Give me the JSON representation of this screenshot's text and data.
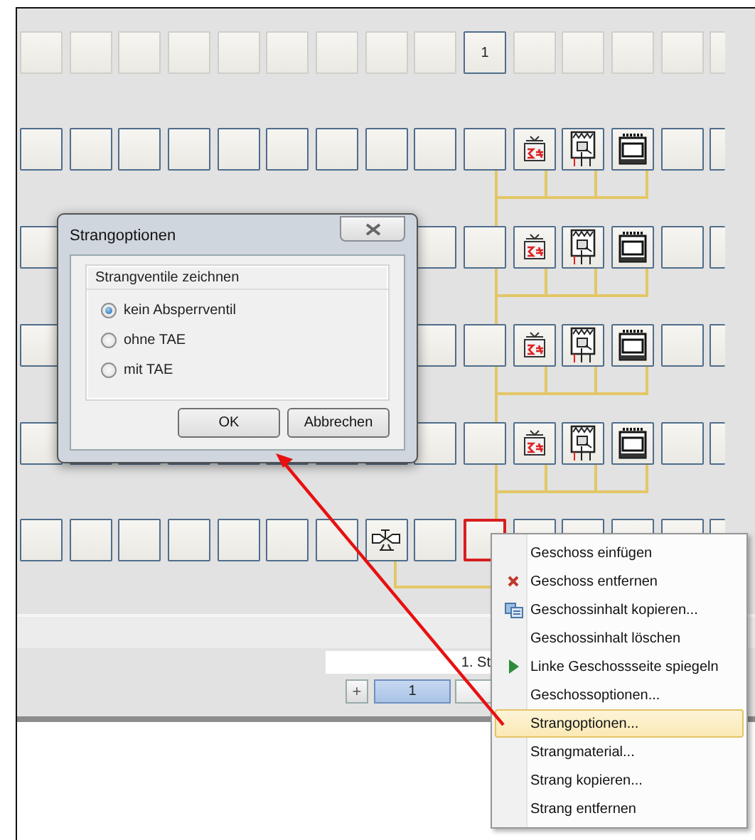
{
  "grid": {
    "header_cell": "1"
  },
  "bottom_bar": {
    "field_value": "1. St",
    "add_button": "+",
    "tabs": [
      {
        "label": "1",
        "selected": true
      },
      {
        "selected": false
      }
    ]
  },
  "dialog": {
    "title": "Strangoptionen",
    "group_title": "Strangventile zeichnen",
    "options": [
      {
        "label": "kein Absperrventil",
        "selected": true
      },
      {
        "label": "ohne TAE",
        "selected": false
      },
      {
        "label": "mit TAE",
        "selected": false
      }
    ],
    "buttons": [
      "OK",
      "Abbrechen"
    ]
  },
  "context_menu": {
    "items": [
      {
        "label": "Geschoss einfügen",
        "kind": "plain",
        "selected": false
      },
      {
        "label": "Geschoss entfernen",
        "kind": "delete",
        "selected": false
      },
      {
        "label": "Geschossinhalt kopieren...",
        "kind": "copy",
        "selected": false
      },
      {
        "label": "Geschossinhalt löschen",
        "kind": "plain",
        "selected": false
      },
      {
        "label": "Linke Geschossseite spiegeln",
        "kind": "play",
        "selected": false
      },
      {
        "label": "Geschossoptionen...",
        "kind": "plain",
        "selected": false
      },
      {
        "label": "Strangoptionen...",
        "kind": "plain",
        "selected": true
      },
      {
        "label": "Strangmaterial...",
        "kind": "plain",
        "selected": false
      },
      {
        "label": "Strang kopieren...",
        "kind": "plain",
        "selected": false
      },
      {
        "label": "Strang entfernen",
        "kind": "plain",
        "selected": false
      }
    ]
  }
}
